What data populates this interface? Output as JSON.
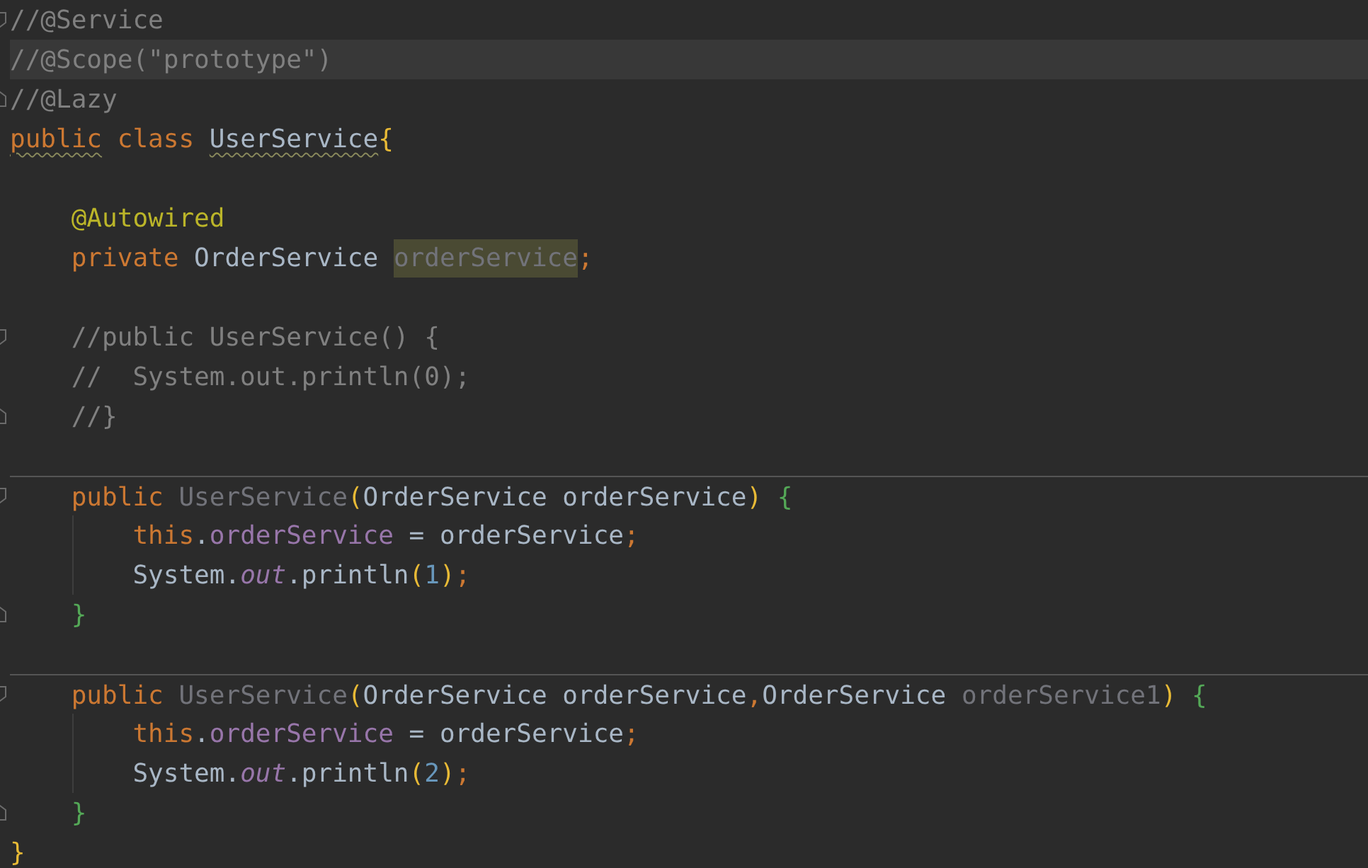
{
  "editor": {
    "lines": [
      {
        "fold_start": true,
        "fold_end": false,
        "current": false,
        "separator_above": false,
        "guide": false,
        "tokens": [
          {
            "kind": "comment",
            "text": "//@Service"
          }
        ]
      },
      {
        "fold_start": false,
        "fold_end": false,
        "current": true,
        "separator_above": false,
        "guide": false,
        "tokens": [
          {
            "kind": "comment",
            "text": "//@Scope(\"prototype\")"
          }
        ]
      },
      {
        "fold_start": false,
        "fold_end": true,
        "current": false,
        "separator_above": false,
        "guide": false,
        "tokens": [
          {
            "kind": "comment",
            "text": "//@Lazy"
          }
        ]
      },
      {
        "fold_start": false,
        "fold_end": false,
        "current": false,
        "separator_above": false,
        "guide": false,
        "tokens": [
          {
            "kind": "keyword",
            "text": "public",
            "warning": true
          },
          {
            "kind": "keyword",
            "text": " class ",
            "warning": false
          },
          {
            "kind": "plain",
            "text": "UserService",
            "warning": true
          },
          {
            "kind": "paren",
            "text": "{"
          }
        ]
      },
      {
        "fold_start": false,
        "fold_end": false,
        "current": false,
        "separator_above": false,
        "guide": false
      },
      {
        "fold_start": false,
        "fold_end": false,
        "current": false,
        "separator_above": false,
        "guide": false,
        "tokens": [
          {
            "kind": "annotation",
            "text": "    @Autowired"
          }
        ]
      },
      {
        "fold_start": false,
        "fold_end": false,
        "current": false,
        "separator_above": false,
        "guide": false,
        "tokens": [
          {
            "kind": "keyword",
            "text": "    private"
          },
          {
            "kind": "plain",
            "text": " OrderService "
          },
          {
            "kind": "unused",
            "text": "orderService",
            "highlighted": true
          },
          {
            "kind": "keyword",
            "text": ";"
          }
        ]
      },
      {
        "fold_start": false,
        "fold_end": false,
        "current": false,
        "separator_above": false,
        "guide": false
      },
      {
        "fold_start": true,
        "fold_end": false,
        "current": false,
        "separator_above": false,
        "guide": false,
        "tokens": [
          {
            "kind": "comment",
            "text": "    //public UserService() {"
          }
        ]
      },
      {
        "fold_start": false,
        "fold_end": false,
        "current": false,
        "separator_above": false,
        "guide": false,
        "tokens": [
          {
            "kind": "comment",
            "text": "    //  System.out.println(0);"
          }
        ]
      },
      {
        "fold_start": false,
        "fold_end": true,
        "current": false,
        "separator_above": false,
        "guide": false,
        "tokens": [
          {
            "kind": "comment",
            "text": "    //}"
          }
        ]
      },
      {
        "fold_start": false,
        "fold_end": false,
        "current": false,
        "separator_above": false,
        "guide": false
      },
      {
        "fold_start": true,
        "fold_end": false,
        "current": false,
        "separator_above": true,
        "guide": false,
        "tokens": [
          {
            "kind": "keyword",
            "text": "    public "
          },
          {
            "kind": "unused",
            "text": "UserService"
          },
          {
            "kind": "paren",
            "text": "("
          },
          {
            "kind": "plain",
            "text": "OrderService orderService"
          },
          {
            "kind": "paren",
            "text": ")"
          },
          {
            "kind": "brace",
            "text": " {"
          }
        ]
      },
      {
        "fold_start": false,
        "fold_end": false,
        "current": false,
        "separator_above": false,
        "guide": true,
        "tokens": [
          {
            "kind": "keyword",
            "text": "        this"
          },
          {
            "kind": "plain",
            "text": "."
          },
          {
            "kind": "field",
            "text": "orderService"
          },
          {
            "kind": "plain",
            "text": " = orderService"
          },
          {
            "kind": "keyword",
            "text": ";"
          }
        ]
      },
      {
        "fold_start": false,
        "fold_end": false,
        "current": false,
        "separator_above": false,
        "guide": true,
        "tokens": [
          {
            "kind": "plain",
            "text": "        System."
          },
          {
            "kind": "static",
            "text": "out"
          },
          {
            "kind": "plain",
            "text": ".println"
          },
          {
            "kind": "paren",
            "text": "("
          },
          {
            "kind": "number",
            "text": "1"
          },
          {
            "kind": "paren",
            "text": ")"
          },
          {
            "kind": "keyword",
            "text": ";"
          }
        ]
      },
      {
        "fold_start": false,
        "fold_end": true,
        "current": false,
        "separator_above": false,
        "guide": false,
        "tokens": [
          {
            "kind": "brace",
            "text": "    }"
          }
        ]
      },
      {
        "fold_start": false,
        "fold_end": false,
        "current": false,
        "separator_above": false,
        "guide": false
      },
      {
        "fold_start": true,
        "fold_end": false,
        "current": false,
        "separator_above": true,
        "guide": false,
        "tokens": [
          {
            "kind": "keyword",
            "text": "    public "
          },
          {
            "kind": "unused",
            "text": "UserService"
          },
          {
            "kind": "paren",
            "text": "("
          },
          {
            "kind": "plain",
            "text": "OrderService orderService"
          },
          {
            "kind": "keyword",
            "text": ","
          },
          {
            "kind": "plain",
            "text": "OrderService "
          },
          {
            "kind": "unused",
            "text": "orderService1"
          },
          {
            "kind": "paren",
            "text": ")"
          },
          {
            "kind": "brace",
            "text": " {"
          }
        ]
      },
      {
        "fold_start": false,
        "fold_end": false,
        "current": false,
        "separator_above": false,
        "guide": true,
        "tokens": [
          {
            "kind": "keyword",
            "text": "        this"
          },
          {
            "kind": "plain",
            "text": "."
          },
          {
            "kind": "field",
            "text": "orderService"
          },
          {
            "kind": "plain",
            "text": " = orderService"
          },
          {
            "kind": "keyword",
            "text": ";"
          }
        ]
      },
      {
        "fold_start": false,
        "fold_end": false,
        "current": false,
        "separator_above": false,
        "guide": true,
        "tokens": [
          {
            "kind": "plain",
            "text": "        System."
          },
          {
            "kind": "static",
            "text": "out"
          },
          {
            "kind": "plain",
            "text": ".println"
          },
          {
            "kind": "paren",
            "text": "("
          },
          {
            "kind": "number",
            "text": "2"
          },
          {
            "kind": "paren",
            "text": ")"
          },
          {
            "kind": "keyword",
            "text": ";"
          }
        ]
      },
      {
        "fold_start": false,
        "fold_end": true,
        "current": false,
        "separator_above": false,
        "guide": false,
        "tokens": [
          {
            "kind": "brace",
            "text": "    }"
          }
        ]
      },
      {
        "fold_start": false,
        "fold_end": false,
        "current": false,
        "separator_above": false,
        "guide": false,
        "tokens": [
          {
            "kind": "paren",
            "text": "}"
          }
        ]
      }
    ]
  }
}
